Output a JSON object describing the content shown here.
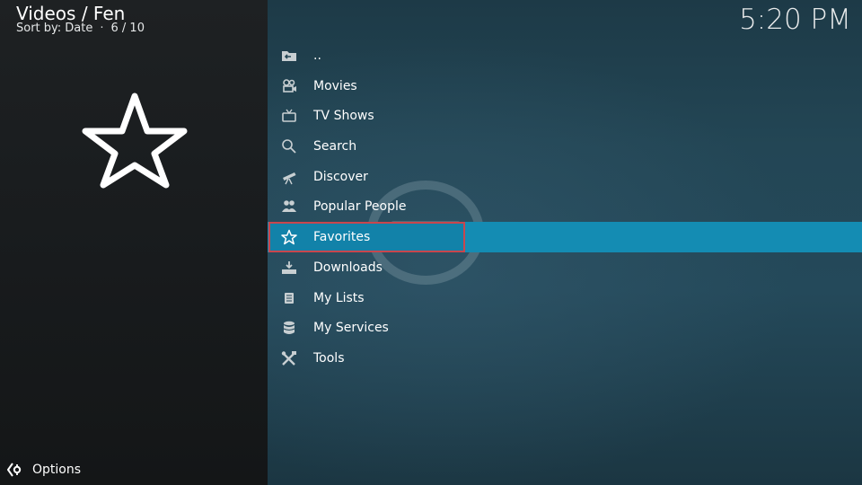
{
  "header": {
    "title": "Videos / Fen",
    "sort_label": "Sort by: Date",
    "separator": "·",
    "position": "6 / 10"
  },
  "clock": "5:20 PM",
  "preview": {
    "icon": "star-outline-icon"
  },
  "menu": {
    "selected_index": 6,
    "items": [
      {
        "label": "..",
        "icon": "folder-back-icon"
      },
      {
        "label": "Movies",
        "icon": "film-camera-icon"
      },
      {
        "label": "TV Shows",
        "icon": "tv-icon"
      },
      {
        "label": "Search",
        "icon": "search-icon"
      },
      {
        "label": "Discover",
        "icon": "telescope-icon"
      },
      {
        "label": "Popular People",
        "icon": "people-icon"
      },
      {
        "label": "Favorites",
        "icon": "star-icon"
      },
      {
        "label": "Downloads",
        "icon": "download-icon"
      },
      {
        "label": "My Lists",
        "icon": "lists-icon"
      },
      {
        "label": "My Services",
        "icon": "database-icon"
      },
      {
        "label": "Tools",
        "icon": "tools-icon"
      }
    ]
  },
  "footer": {
    "options_label": "Options",
    "icon": "options-icon"
  },
  "colors": {
    "highlight": "#148cb3",
    "focus_border": "#c9464d",
    "left_panel": "#1b1e20",
    "right_panel": "#234655"
  }
}
